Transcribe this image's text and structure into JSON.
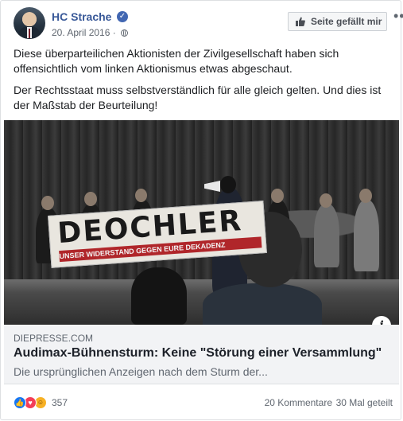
{
  "post": {
    "author": "HC Strache",
    "date": "20. April 2016",
    "like_page_label": "Seite gefällt mir",
    "text": [
      "Diese überparteilichen Aktionisten der Zivilgesellschaft haben sich offensichtlich vom linken Aktionismus etwas abgeschaut.",
      "Der Rechtsstaat muss selbstverständlich für alle gleich gelten. Und dies ist der Maßstab der Beurteilung!"
    ]
  },
  "image": {
    "banner_text": "DEOCHLER",
    "banner_subtext": "UNSER WIDERSTAND GEGEN EURE DEKADENZ"
  },
  "link": {
    "domain": "DIEPRESSE.COM",
    "title": "Audimax-Bühnensturm: Keine \"Störung einer Versammlung\"",
    "description": "Die ursprünglichen Anzeigen nach dem Sturm der..."
  },
  "footer": {
    "reaction_count": "357",
    "comments": "20 Kommentare",
    "shares": "30 Mal geteilt"
  },
  "icons": {
    "verified": "verified-badge-icon",
    "privacy": "globe-icon",
    "like": "thumbs-up-icon",
    "more": "more-options-icon",
    "info": "info-icon"
  },
  "colors": {
    "link_name": "#385898",
    "like_reaction": "#1877f2",
    "love_reaction": "#f33e58",
    "haha_reaction": "#f7b125"
  }
}
